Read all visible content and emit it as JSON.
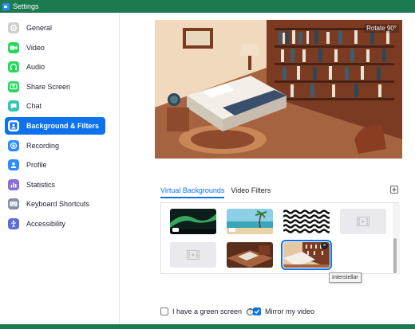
{
  "window": {
    "title": "Settings"
  },
  "sidebar": {
    "items": [
      {
        "label": "General",
        "icon": "gear-icon",
        "color": "#d0d0d0"
      },
      {
        "label": "Video",
        "icon": "video-camera-icon",
        "color": "#23d959"
      },
      {
        "label": "Audio",
        "icon": "headphones-icon",
        "color": "#23d959"
      },
      {
        "label": "Share Screen",
        "icon": "share-screen-icon",
        "color": "#23d959"
      },
      {
        "label": "Chat",
        "icon": "chat-bubble-icon",
        "color": "#2fc6b4"
      },
      {
        "label": "Background & Filters",
        "icon": "background-person-icon",
        "color": "#ffffff",
        "active": true
      },
      {
        "label": "Recording",
        "icon": "record-icon",
        "color": "#2d8cff"
      },
      {
        "label": "Profile",
        "icon": "profile-icon",
        "color": "#2d8cff"
      },
      {
        "label": "Statistics",
        "icon": "statistics-chart-icon",
        "color": "#8a6dd6"
      },
      {
        "label": "Keyboard Shortcuts",
        "icon": "keyboard-icon",
        "color": "#8a8fa8"
      },
      {
        "label": "Accessibility",
        "icon": "accessibility-person-icon",
        "color": "#5b6cd6"
      }
    ]
  },
  "preview": {
    "rotate_label": "Rotate 90°"
  },
  "tabs": {
    "virtual_backgrounds": "Virtual Backgrounds",
    "video_filters": "Video Filters"
  },
  "thumbnails": [
    {
      "name": "Aurora",
      "kind": "video"
    },
    {
      "name": "Beach",
      "kind": "video"
    },
    {
      "name": "Pattern",
      "kind": "image"
    },
    {
      "name": "Empty",
      "kind": "placeholder"
    },
    {
      "name": "Empty",
      "kind": "placeholder"
    },
    {
      "name": "Room",
      "kind": "image"
    },
    {
      "name": "Interstellar",
      "kind": "image",
      "selected": true
    }
  ],
  "tooltip": {
    "text": "Interstellar"
  },
  "options": {
    "green_screen_label": "I have a green screen",
    "green_screen_checked": false,
    "mirror_label": "Mirror my video",
    "mirror_checked": true
  },
  "colors": {
    "accent": "#0e72ed",
    "titlebar": "#1b7a4f"
  }
}
